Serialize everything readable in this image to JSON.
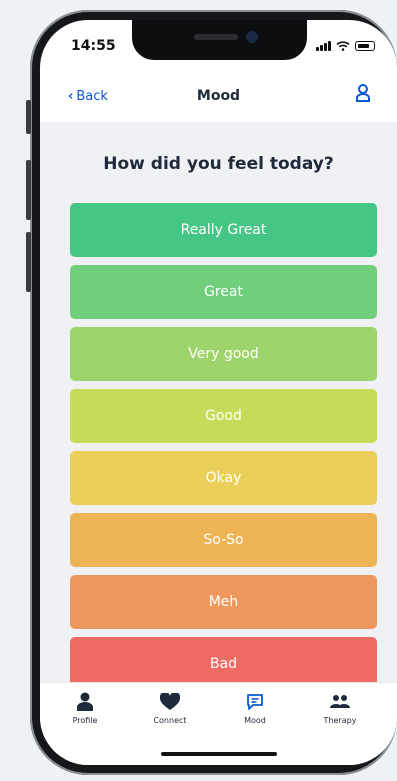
{
  "status": {
    "time": "14:55"
  },
  "nav": {
    "back_label": "Back",
    "title": "Mood",
    "profile_icon": "person-icon"
  },
  "question": "How did you feel today?",
  "moods": [
    {
      "label": "Really Great",
      "color": "#45c684"
    },
    {
      "label": "Great",
      "color": "#6fcf7d"
    },
    {
      "label": "Very good",
      "color": "#9fd36c"
    },
    {
      "label": "Good",
      "color": "#c7db5a"
    },
    {
      "label": "Okay",
      "color": "#ead05a"
    },
    {
      "label": "So-So",
      "color": "#ecb454"
    },
    {
      "label": "Meh",
      "color": "#ee975f"
    },
    {
      "label": "Bad",
      "color": "#f06b63"
    }
  ],
  "tabs": [
    {
      "label": "Profile",
      "icon": "person-icon"
    },
    {
      "label": "Connect",
      "icon": "heart-icon"
    },
    {
      "label": "Mood",
      "icon": "chat-icon"
    },
    {
      "label": "Therapy",
      "icon": "group-icon"
    }
  ],
  "colors": {
    "accent": "#0a58d6"
  }
}
